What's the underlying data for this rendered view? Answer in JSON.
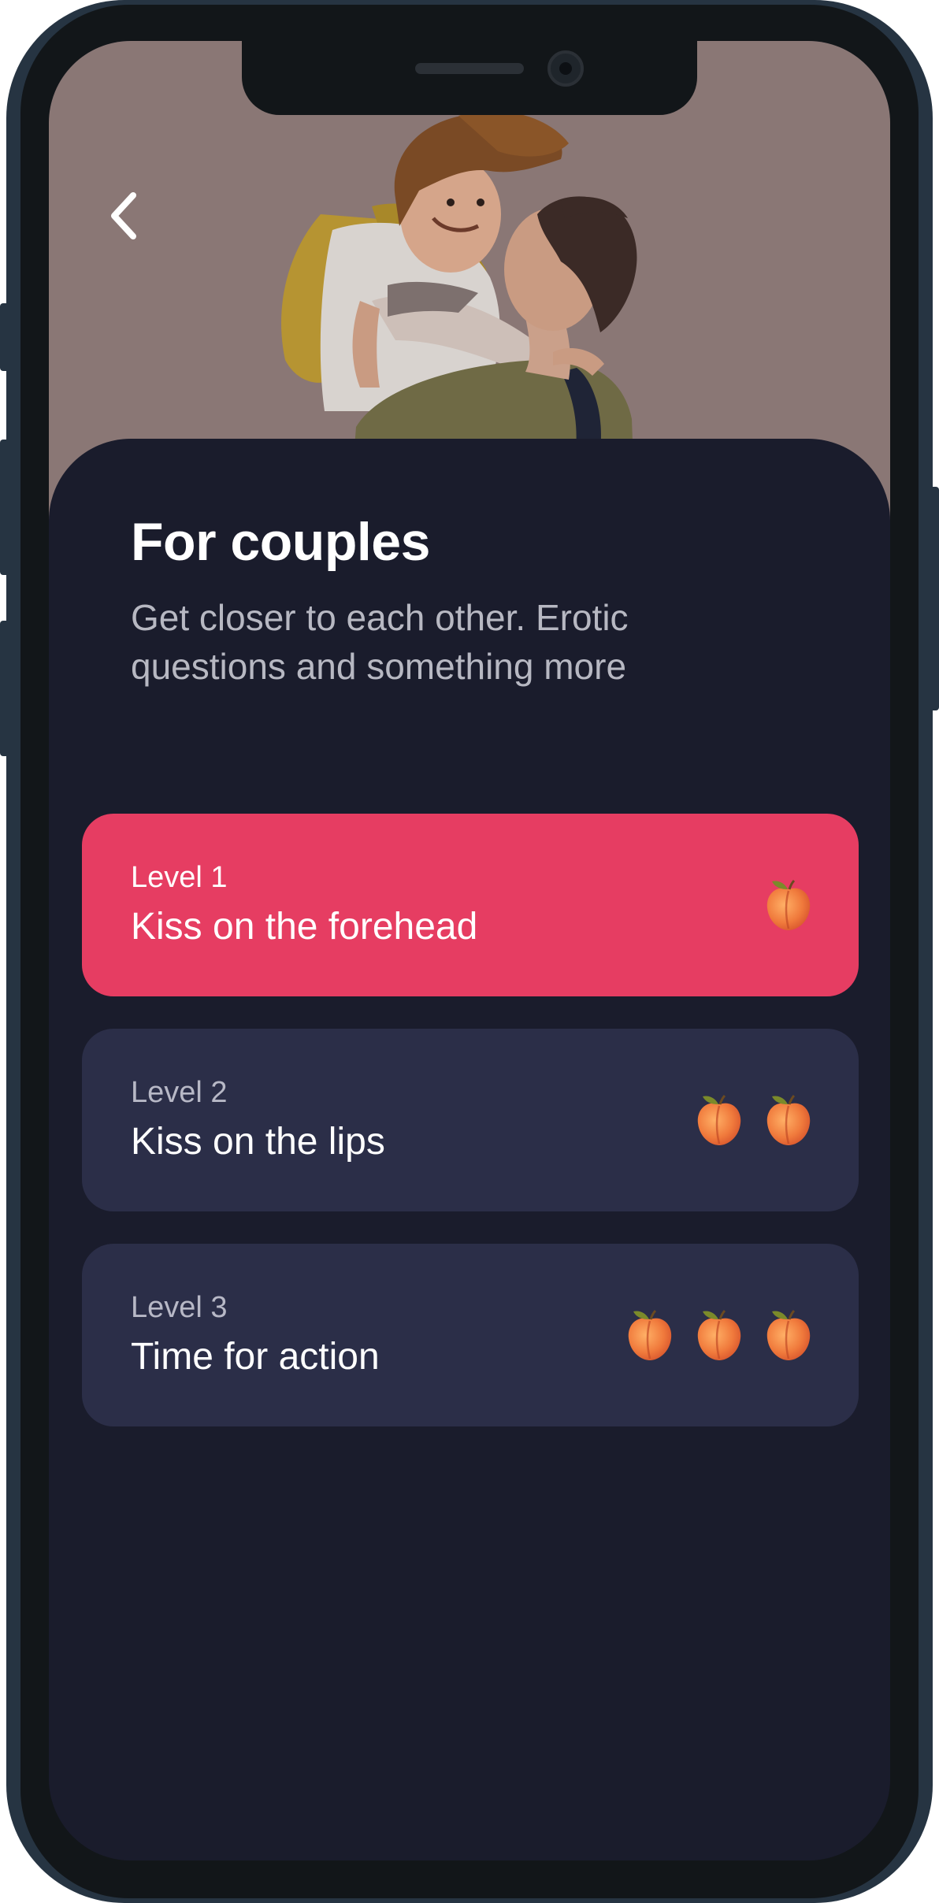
{
  "colors": {
    "background": "#1a1c2c",
    "card": "#2b2e48",
    "card_active": "#e63d62",
    "hero": "#8a7775"
  },
  "hero": {
    "illustration": "couple-hug-illustration",
    "back_icon": "chevron-left-icon"
  },
  "header": {
    "title": "For couples",
    "subtitle": "Get closer to each other. Erotic questions and something more"
  },
  "levels": [
    {
      "label": "Level 1",
      "title": "Kiss on the forehead",
      "peach_count": 1,
      "selected": true
    },
    {
      "label": "Level 2",
      "title": "Kiss on the lips",
      "peach_count": 2,
      "selected": false
    },
    {
      "label": "Level 3",
      "title": "Time for action",
      "peach_count": 3,
      "selected": false
    }
  ],
  "peach_icon": "peach-icon"
}
